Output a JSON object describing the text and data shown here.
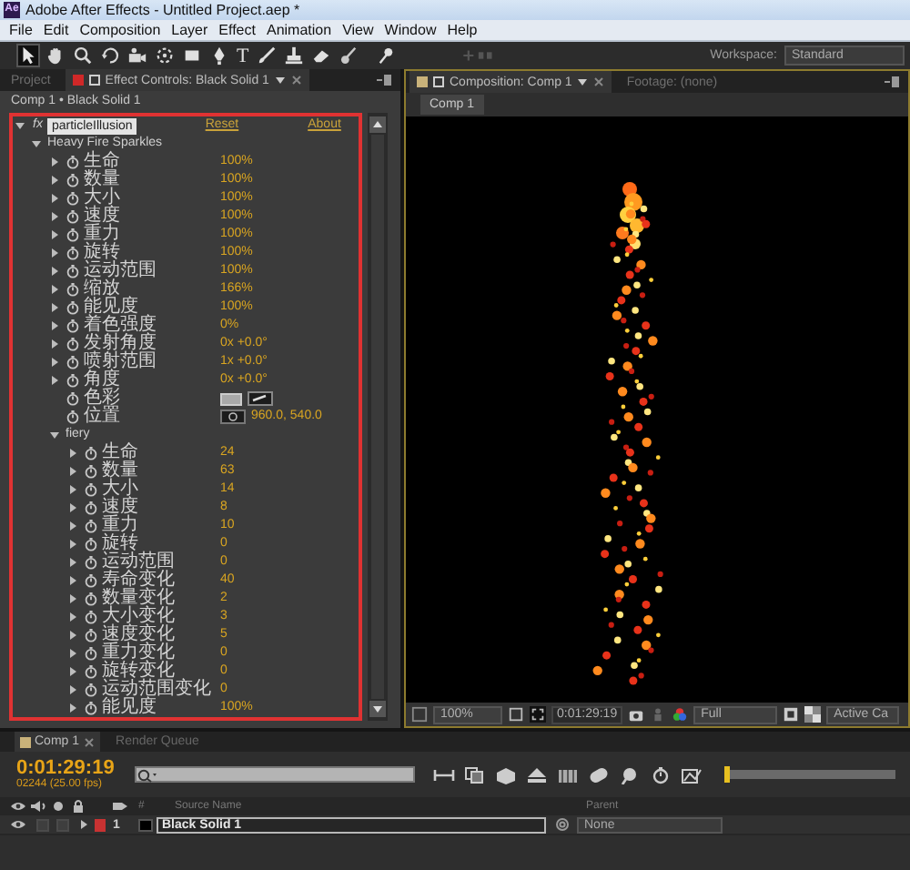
{
  "window": {
    "app_badge": "Ae",
    "title": "Adobe After Effects - Untitled Project.aep *"
  },
  "menu": [
    "File",
    "Edit",
    "Composition",
    "Layer",
    "Effect",
    "Animation",
    "View",
    "Window",
    "Help"
  ],
  "toolbar": {
    "text_tool": "T",
    "workspace_label": "Workspace:",
    "workspace": "Standard"
  },
  "left_panel": {
    "tabs": [
      {
        "label": "Project",
        "selected": false
      },
      {
        "label": "Effect Controls: Black Solid 1",
        "selected": true
      }
    ],
    "breadcrumb": "Comp 1 • Black Solid 1",
    "effect": {
      "badge": "fx",
      "name": "particleIllusion",
      "selected": true,
      "expanded": true,
      "reset": "Reset",
      "about": "About",
      "children": [
        {
          "kind": "group",
          "name": "Heavy Fire Sparkles",
          "expanded": true,
          "children": [
            {
              "kind": "value",
              "label": "生命",
              "value": "100%"
            },
            {
              "kind": "value",
              "label": "数量",
              "value": "100%"
            },
            {
              "kind": "value",
              "label": "大小",
              "value": "100%"
            },
            {
              "kind": "value",
              "label": "速度",
              "value": "100%"
            },
            {
              "kind": "value",
              "label": "重力",
              "value": "100%"
            },
            {
              "kind": "value",
              "label": "旋转",
              "value": "100%"
            },
            {
              "kind": "value",
              "label": "运动范围",
              "value": "100%"
            },
            {
              "kind": "value",
              "label": "缩放",
              "value": "166%"
            },
            {
              "kind": "value",
              "label": "能见度",
              "value": "100%"
            },
            {
              "kind": "value",
              "label": "着色强度",
              "value": "0%"
            },
            {
              "kind": "value",
              "label": "发射角度",
              "value": "0x +0.0°"
            },
            {
              "kind": "value",
              "label": "喷射范围",
              "value": "1x +0.0°"
            },
            {
              "kind": "value",
              "label": "角度",
              "value": "0x +0.0°"
            },
            {
              "kind": "color",
              "label": "色彩",
              "color": "#a8a8a8"
            },
            {
              "kind": "point",
              "label": "位置",
              "value": "960.0, 540.0"
            },
            {
              "kind": "group",
              "name": "fiery",
              "expanded": true,
              "children": [
                {
                  "kind": "value",
                  "label": "生命",
                  "value": "24"
                },
                {
                  "kind": "value",
                  "label": "数量",
                  "value": "63"
                },
                {
                  "kind": "value",
                  "label": "大小",
                  "value": "14"
                },
                {
                  "kind": "value",
                  "label": "速度",
                  "value": "8"
                },
                {
                  "kind": "value",
                  "label": "重力",
                  "value": "10"
                },
                {
                  "kind": "value",
                  "label": "旋转",
                  "value": "0"
                },
                {
                  "kind": "value",
                  "label": "运动范围",
                  "value": "0"
                },
                {
                  "kind": "value",
                  "label": "寿命变化",
                  "value": "40"
                },
                {
                  "kind": "value",
                  "label": "数量变化",
                  "value": "2"
                },
                {
                  "kind": "value",
                  "label": "大小变化",
                  "value": "3"
                },
                {
                  "kind": "value",
                  "label": "速度变化",
                  "value": "5"
                },
                {
                  "kind": "value",
                  "label": "重力变化",
                  "value": "0"
                },
                {
                  "kind": "value",
                  "label": "旋转变化",
                  "value": "0"
                },
                {
                  "kind": "value",
                  "label": "运动范围变化",
                  "value": "0"
                },
                {
                  "kind": "value",
                  "label": "能见度",
                  "value": "100%"
                }
              ]
            }
          ]
        }
      ]
    }
  },
  "composition_panel": {
    "tabs": [
      {
        "label": "Composition: Comp 1",
        "selected": true
      },
      {
        "label": "Footage: (none)",
        "selected": false
      }
    ],
    "comp_name": "Comp 1",
    "viewer_bar": {
      "magnification": "100%",
      "timecode": "0:01:29:19",
      "resolution": "Full",
      "camera": "Active Ca"
    }
  },
  "timeline": {
    "tabs": [
      {
        "label": "Comp 1",
        "selected": true
      },
      {
        "label": "Render Queue",
        "selected": false
      }
    ],
    "current_time": "0:01:29:19",
    "frame_info": "02244 (25.00 fps)",
    "columns": {
      "number": "#",
      "source_name": "Source Name",
      "parent": "Parent"
    },
    "layers": [
      {
        "number": "1",
        "name": "Black Solid 1",
        "color": "#c83232",
        "selected": true,
        "solo": false,
        "locked": false,
        "parent": "None"
      }
    ]
  }
}
